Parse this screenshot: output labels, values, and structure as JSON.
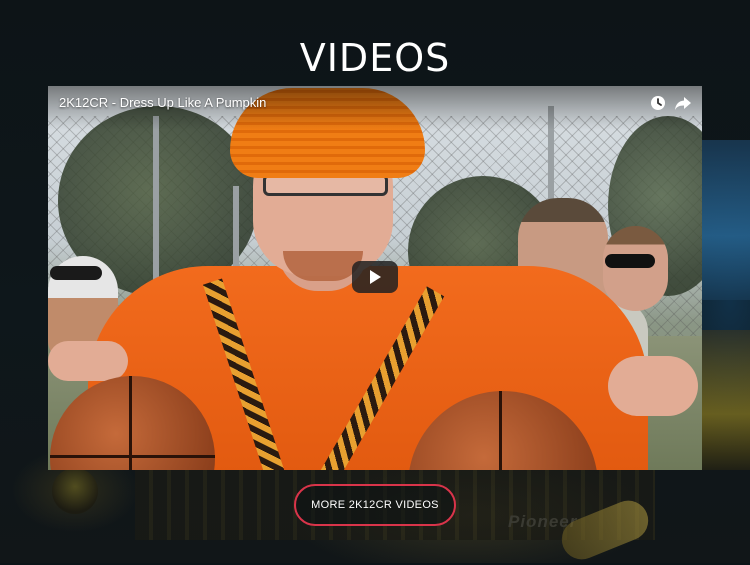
{
  "page": {
    "title": "VIDEOS"
  },
  "video": {
    "title": "2K12CR - Dress Up Like A Pumpkin",
    "icons": {
      "watch_later": "clock-icon",
      "share": "share-icon",
      "play": "play-icon"
    }
  },
  "more_button": {
    "label": "MORE 2K12CR VIDEOS",
    "border_color": "#d9344a"
  },
  "background": {
    "logo_text": "Pioneer"
  }
}
